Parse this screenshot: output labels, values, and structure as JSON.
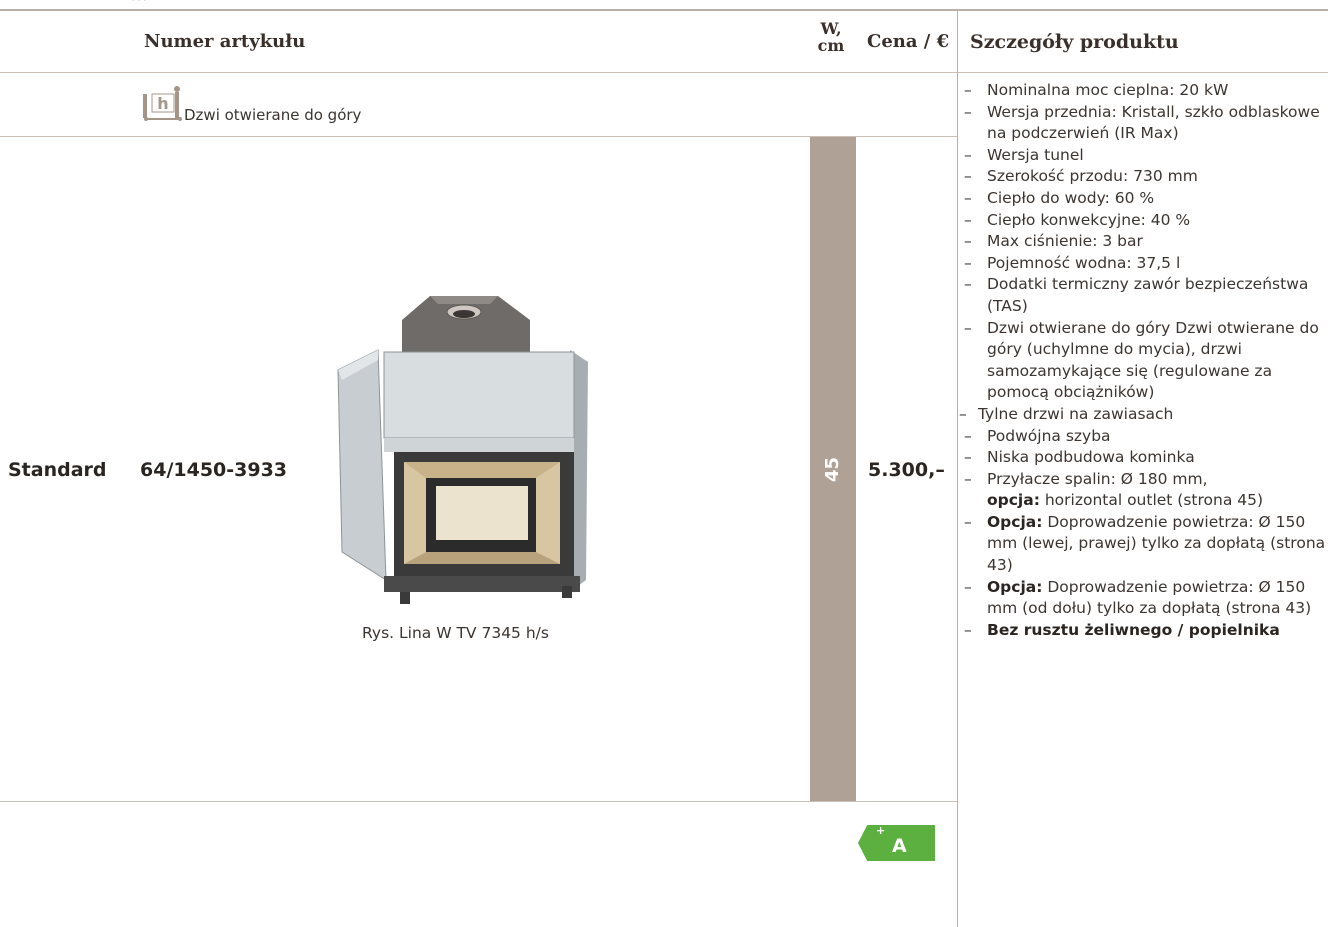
{
  "table": {
    "headers": {
      "article": "Numer artykułu",
      "width": "W, cm",
      "price": "Cena / €",
      "details": "Szczegóły produktu"
    },
    "door_type_label": "Dzwi otwierane do góry",
    "door_icon_letter": "h",
    "row": {
      "variant": "Standard",
      "article_number": "64/1450-3933",
      "width_cm": "45",
      "price": "5.300,–",
      "image_caption": "Rys. Lina W TV 7345 h/s"
    }
  },
  "details": [
    {
      "text": "Nominalna moc cieplna: 20 kW"
    },
    {
      "text": "Wersja przednia: Kristall, szkło odblas­kowe na podczerwień (IR Max)"
    },
    {
      "text": "Wersja tunel"
    },
    {
      "text": "Szerokość przodu: 730 mm"
    },
    {
      "text": "Ciepło do wody: 60 %"
    },
    {
      "text": "Ciepło konwekcyjne: 40 %"
    },
    {
      "text": "Max ciśnienie: 3 bar"
    },
    {
      "text": "Pojemność wodna: 37,5 l"
    },
    {
      "text": "Dodatki termiczny zawór bezpieczeńst­wa (TAS)"
    },
    {
      "text": "Dzwi otwierane do góry Dzwi otwierane do góry (uchylmne do my­cia), drzwi samozamykające się (regulowane za pomocą obciążników)"
    },
    {
      "text": "Tylne drzwi na zawiasach",
      "narrow": true
    },
    {
      "text": "Podwójna szyba"
    },
    {
      "text": "Niska podbudowa kominka"
    },
    {
      "text": "Przyłacze spalin: Ø 180 mm,",
      "bold_suffix_line": "opcja:",
      "rest": " horizontal outlet (strona 45)"
    },
    {
      "bold": "Opcja:",
      "text": " Doprowadzenie powietrza: Ø 150 mm (lewej, prawej) tylko za dopłatą (strona 43)"
    },
    {
      "bold": "Opcja:",
      "text": " Doprowadzenie powietrza: Ø 150 mm (od dołu) tylko za dopłatą (strona 43)"
    },
    {
      "bold": "Bez rusztu żeliwnego / popielnika",
      "text": ""
    }
  ],
  "energy_label": {
    "class": "A",
    "plus": "+",
    "color": "#5cb03f"
  },
  "colors": {
    "accent_bar": "#afa196",
    "divider": "#cbbfb6"
  }
}
